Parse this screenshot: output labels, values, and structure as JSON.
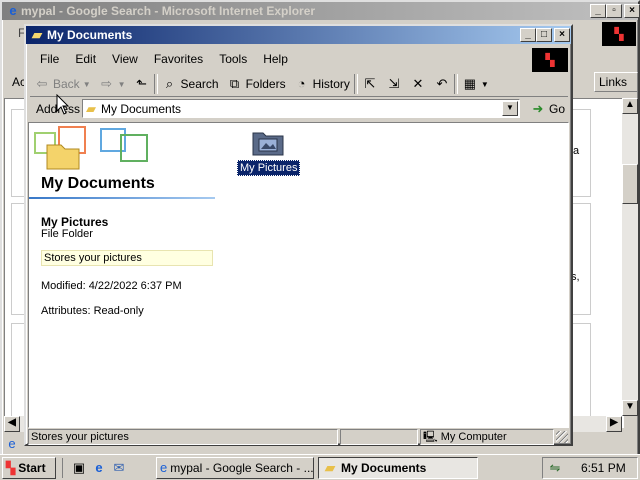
{
  "ie": {
    "title": "mypal - Google Search - Microsoft Internet Explorer",
    "menu_left": "Fi",
    "toolbar_left": "Ac",
    "links_label": "Links",
    "right_snippets": [
      "a",
      "s,"
    ]
  },
  "explorer": {
    "title": "My Documents",
    "menu": [
      "File",
      "Edit",
      "View",
      "Favorites",
      "Tools",
      "Help"
    ],
    "toolbar": {
      "back": "Back",
      "search": "Search",
      "folders": "Folders",
      "history": "History"
    },
    "address": {
      "label": "Address",
      "value": "My Documents",
      "go": "Go"
    },
    "sidepanel": {
      "folder_title": "My Documents",
      "item_name": "My Pictures",
      "item_type": "File Folder",
      "description": "Stores your pictures",
      "modified": "Modified: 4/22/2022 6:37 PM",
      "attributes": "Attributes: Read-only"
    },
    "files": [
      {
        "name": "My Pictures",
        "selected": true
      }
    ],
    "status": {
      "text": "Stores your pictures",
      "zone": "My Computer"
    }
  },
  "taskbar": {
    "start": "Start",
    "tasks": [
      {
        "label": "mypal - Google Search - ...",
        "active": false
      },
      {
        "label": "My Documents",
        "active": true
      }
    ],
    "clock": "6:51 PM"
  },
  "colors": {
    "desktop": "#3a6ea5",
    "active_title": "#0a246a",
    "selection": "#0a246a",
    "face": "#d4d0c8"
  }
}
